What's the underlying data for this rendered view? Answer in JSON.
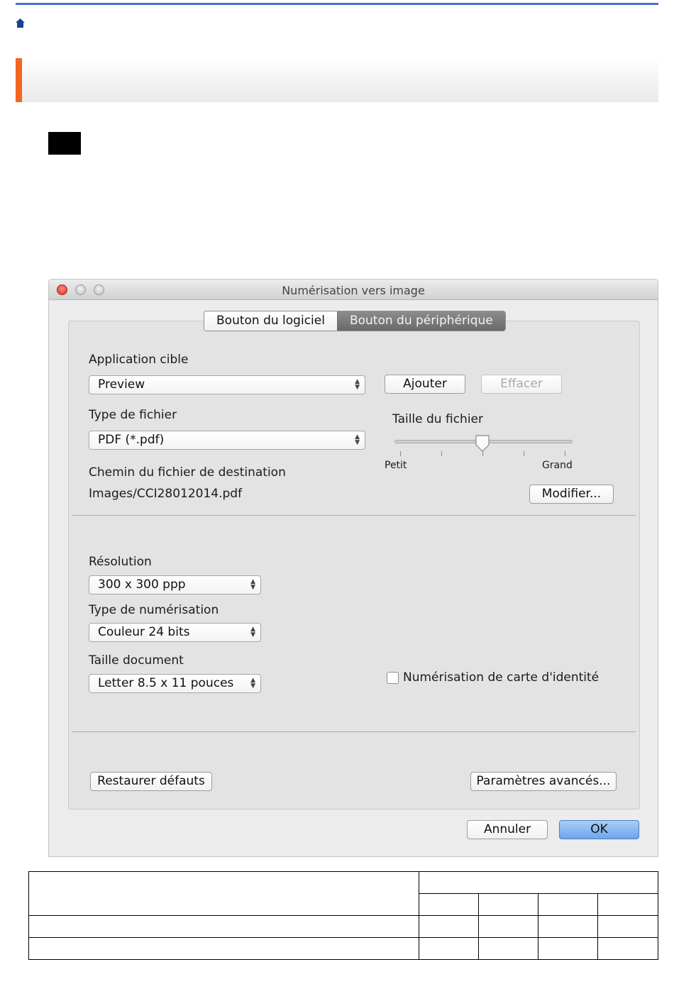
{
  "breadcrumb": {
    "home_icon": "home-icon"
  },
  "window": {
    "title": "Numérisation vers image",
    "tabs": [
      {
        "label": "Bouton du logiciel",
        "selected": false
      },
      {
        "label": "Bouton du périphérique",
        "selected": true
      }
    ],
    "target_app": {
      "label": "Application cible",
      "value": "Preview"
    },
    "add_label": "Ajouter",
    "delete_label": "Effacer",
    "file_type": {
      "label": "Type de fichier",
      "value": "PDF (*.pdf)"
    },
    "file_size": {
      "label": "Taille du fichier",
      "min_label": "Petit",
      "max_label": "Grand",
      "level": 0.5
    },
    "dest_path": {
      "label": "Chemin du fichier de destination",
      "value": "Images/CCI28012014.pdf"
    },
    "modify_label": "Modifier...",
    "resolution": {
      "label": "Résolution",
      "value": "300 x 300 ppp"
    },
    "scan_type": {
      "label": "Type de numérisation",
      "value": "Couleur 24 bits"
    },
    "doc_size": {
      "label": "Taille document",
      "value": "Letter 8.5 x 11 pouces"
    },
    "id_card": {
      "label": "Numérisation de carte d'identité",
      "checked": false
    },
    "restore_label": "Restaurer défauts",
    "advanced_label": "Paramètres avancés...",
    "cancel_label": "Annuler",
    "ok_label": "OK"
  },
  "colors": {
    "accent": "#f26522",
    "rule": "#4a6fc7",
    "primary_button": "#6ea6ea"
  }
}
